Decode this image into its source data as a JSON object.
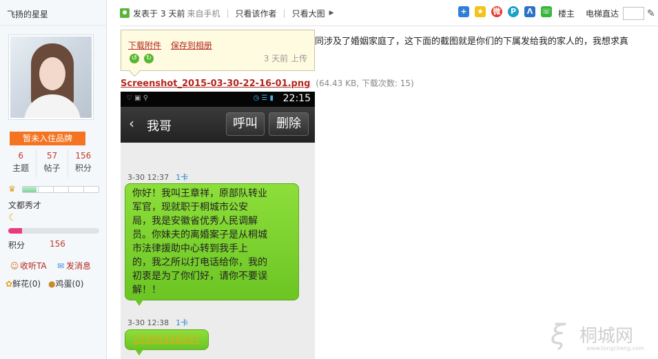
{
  "author": {
    "username": "飞扬的星星",
    "brand_badge": "暂未入住品牌",
    "stats": [
      {
        "value": "6",
        "label": "主题"
      },
      {
        "value": "57",
        "label": "帖子"
      },
      {
        "value": "156",
        "label": "积分"
      }
    ],
    "level_progress": 0.18,
    "rank_name": "文都秀才",
    "rank_progress": 0.15,
    "points_label": "积分",
    "points_value": "156",
    "actions": {
      "follow": "收听TA",
      "message": "发消息"
    },
    "gifts": {
      "flower": "鲜花(0)",
      "egg": "鸡蛋(0)"
    }
  },
  "post": {
    "meta": {
      "posted_prefix": "发表于",
      "posted_time": "3 天前",
      "source": "来自手机",
      "only_author": "只看该作者",
      "only_image": "只看大图",
      "floor_label": "楼主",
      "jump_label": "电梯直达"
    },
    "share_icons": [
      "plus-share-icon",
      "qzone-icon",
      "weibo-icon",
      "p-share-icon",
      "tencent-weibo-icon",
      "wechat-icon"
    ],
    "body_text": "同涉及了婚姻家庭了，这下面的截图就是你们的下属发给我的家人的，我想求真",
    "tooltip": {
      "download": "下载附件",
      "save_album": "保存到相册",
      "uploaded": "3 天前 上传"
    },
    "attachment": {
      "filename": "Screenshot_2015-03-30-22-16-01.png",
      "info": "(64.43 KB, 下载次数: 15)"
    }
  },
  "phone": {
    "clock": "22:15",
    "contact": "我哥",
    "call_btn": "呼叫",
    "delete_btn": "删除",
    "messages": [
      {
        "time": "3-30 12:37",
        "card": "1卡",
        "lines": [
          "你好！我叫王章祥，原部队转业",
          "军官，现就职于桐城市公安",
          "局，我是安徽省优秀人民调解",
          "员。你妹夫的离婚案子是从桐城",
          "市法律援助中心转到我手上",
          "的，我之所以打电话给你，我的",
          "初衷是为了你们好，请你不要误",
          "解！！"
        ]
      },
      {
        "time": "3-30 12:38",
        "card": "1卡",
        "phone_number": "13305566207"
      }
    ]
  },
  "watermark": {
    "name": "桐城网",
    "url": "www.tongcheng.com"
  }
}
